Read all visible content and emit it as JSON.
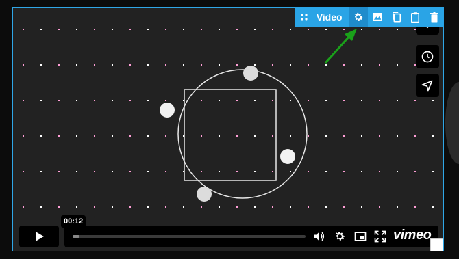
{
  "toolbar": {
    "label": "Video",
    "icons": [
      "drag-handle-icon",
      "gear-icon",
      "image-icon",
      "copy-icon",
      "clipboard-icon",
      "trash-icon"
    ]
  },
  "player": {
    "time_tooltip": "00:12",
    "brand": "vimeo",
    "progress_fraction": 0.03
  },
  "sidebar": {
    "buttons": [
      "heart-icon",
      "clock-icon",
      "send-icon"
    ]
  },
  "colors": {
    "accent": "#2aa4e6",
    "arrow": "#1aa11a",
    "video_bg": "#222222"
  }
}
